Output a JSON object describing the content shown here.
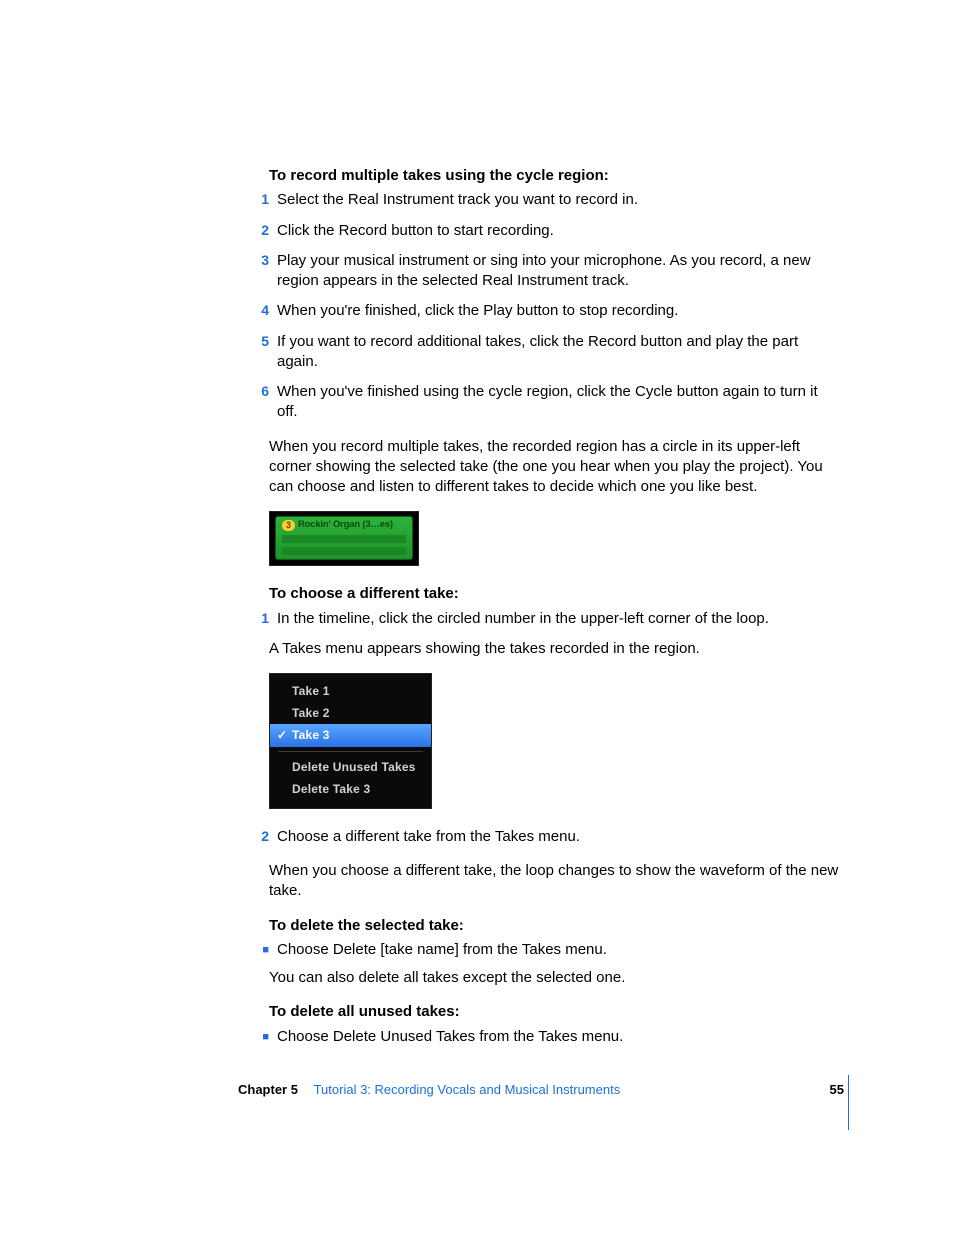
{
  "section1": {
    "heading": "To record multiple takes using the cycle region:",
    "steps": [
      "Select the Real Instrument track you want to record in.",
      "Click the Record button to start recording.",
      "Play your musical instrument or sing into your microphone. As you record, a new region appears in the selected Real Instrument track.",
      "When you're finished, click the Play button to stop recording.",
      "If you want to record additional takes, click the Record button and play the part again.",
      "When you've finished using the cycle region, click the Cycle button again to turn it off."
    ],
    "note": "When you record multiple takes, the recorded region has a circle in its upper-left corner showing the selected take (the one you hear when you play the project). You can choose and listen to different takes to decide which one you like best."
  },
  "shot1": {
    "badge": "3",
    "label": "Rockin' Organ  (3…es)"
  },
  "section2": {
    "heading": "To choose a different take:",
    "step1": "In the timeline, click the circled number in the upper-left corner of the loop.",
    "note1": "A Takes menu appears showing the takes recorded in the region."
  },
  "shot2": {
    "items": [
      "Take 1",
      "Take 2",
      "Take 3"
    ],
    "selectedIndex": 2,
    "check": "✓",
    "after": [
      "Delete Unused Takes",
      "Delete Take 3"
    ]
  },
  "section2b": {
    "step2": "Choose a different take from the Takes menu.",
    "note2": "When you choose a different take, the loop changes to show the waveform of the new take."
  },
  "section3": {
    "heading": "To delete the selected take:",
    "bullet": "Choose Delete [take name] from the Takes menu.",
    "note": "You can also delete all takes except the selected one."
  },
  "section4": {
    "heading": "To delete all unused takes:",
    "bullet": "Choose Delete Unused Takes from the Takes menu."
  },
  "footer": {
    "chapter": "Chapter 5",
    "title": "Tutorial 3:  Recording Vocals and Musical Instruments",
    "page": "55"
  }
}
